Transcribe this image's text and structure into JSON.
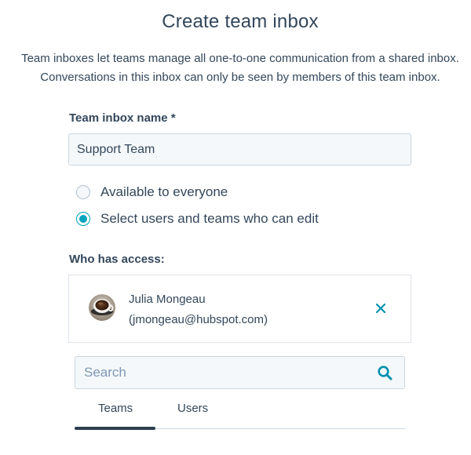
{
  "dialog": {
    "title": "Create team inbox",
    "description_line1": "Team inboxes let teams manage all one-to-one communication from a shared inbox.",
    "description_line2": "Conversations in this inbox can only be seen by members of this team inbox."
  },
  "name_field": {
    "label": "Team inbox name *",
    "value": "Support Team"
  },
  "visibility": {
    "options": [
      {
        "label": "Available to everyone",
        "selected": false
      },
      {
        "label": "Select users and teams who can edit",
        "selected": true
      }
    ]
  },
  "access": {
    "label": "Who has access:",
    "members": [
      {
        "name": "Julia Mongeau",
        "email": "(jmongeau@hubspot.com)",
        "avatar_icon": "coffee-cup-avatar",
        "remove_icon": "close-icon"
      }
    ]
  },
  "search": {
    "placeholder": "Search",
    "value": "",
    "icon": "search-icon"
  },
  "tabs": [
    {
      "label": "Teams",
      "active": true
    },
    {
      "label": "Users",
      "active": false
    }
  ],
  "colors": {
    "text": "#33475b",
    "accent": "#00a4bd",
    "input_bg": "#f5f8fa",
    "border": "#cbd6e2",
    "tab_indicator": "#2d3e50"
  }
}
